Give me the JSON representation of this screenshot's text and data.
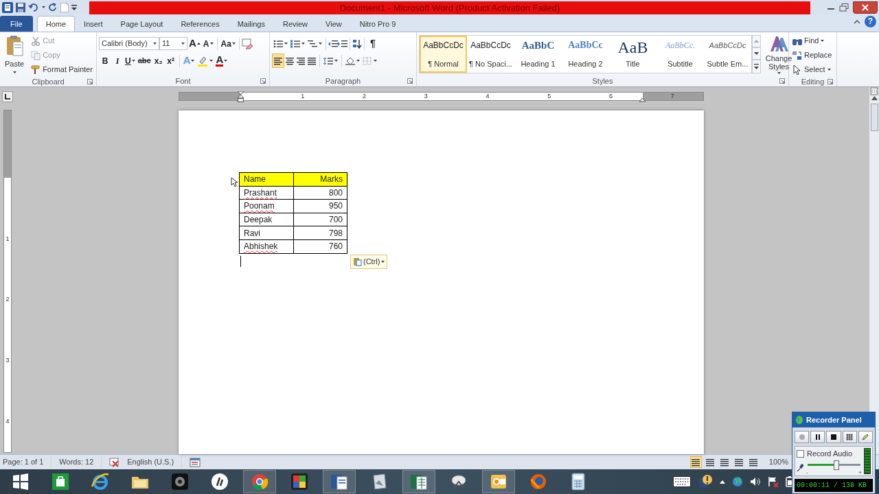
{
  "window": {
    "title": "Document1  -  Microsoft Word (Product Activation Failed)",
    "help_label": "?"
  },
  "tabs": [
    {
      "label": "File",
      "kind": "file",
      "selected": false
    },
    {
      "label": "Home",
      "kind": "tab",
      "selected": true
    },
    {
      "label": "Insert",
      "kind": "tab",
      "selected": false
    },
    {
      "label": "Page Layout",
      "kind": "tab",
      "selected": false
    },
    {
      "label": "References",
      "kind": "tab",
      "selected": false
    },
    {
      "label": "Mailings",
      "kind": "tab",
      "selected": false
    },
    {
      "label": "Review",
      "kind": "tab",
      "selected": false
    },
    {
      "label": "View",
      "kind": "tab",
      "selected": false
    },
    {
      "label": "Nitro Pro 9",
      "kind": "tab",
      "selected": false
    }
  ],
  "clipboard": {
    "label": "Clipboard",
    "paste": "Paste",
    "items": [
      {
        "label": "Cut",
        "kind": "cut",
        "disabled": true
      },
      {
        "label": "Copy",
        "kind": "copy",
        "disabled": true
      },
      {
        "label": "Format Painter",
        "kind": "painter",
        "disabled": false
      }
    ]
  },
  "font": {
    "label": "Font",
    "font_name": "Calibri (Body)",
    "font_size": "11",
    "row1": [
      {
        "label": "A",
        "kind": "grow"
      },
      {
        "label": "A",
        "kind": "shrink"
      },
      {
        "label": "Aa",
        "kind": "case"
      }
    ],
    "row2": [
      {
        "label": "B",
        "kind": "bold"
      },
      {
        "label": "I",
        "kind": "italic"
      },
      {
        "label": "U",
        "kind": "underline"
      },
      {
        "label": "abc",
        "kind": "strike"
      },
      {
        "label": "x₂",
        "kind": "sub"
      },
      {
        "label": "x²",
        "kind": "sup"
      },
      {
        "label": "A",
        "kind": "effects"
      },
      {
        "label": "A",
        "kind": "color"
      }
    ]
  },
  "paragraph": {
    "label": "Paragraph",
    "pilcrow": "¶",
    "alignment": [
      {
        "selected": true
      },
      {
        "selected": false
      },
      {
        "selected": false
      },
      {
        "selected": false
      }
    ]
  },
  "styles": {
    "label": "Styles",
    "change_styles": "Change Styles",
    "items": [
      {
        "preview": "AaBbCcDc",
        "label": "¶ Normal",
        "kind": "body",
        "selected": true
      },
      {
        "preview": "AaBbCcDc",
        "label": "¶ No Spaci...",
        "kind": "body",
        "selected": false
      },
      {
        "preview": "AaBbC",
        "label": "Heading 1",
        "kind": "heading1",
        "selected": false
      },
      {
        "preview": "AaBbCc",
        "label": "Heading 2",
        "kind": "heading2",
        "selected": false
      },
      {
        "preview": "AaB",
        "label": "Title",
        "kind": "title",
        "selected": false
      },
      {
        "preview": "AaBbCc.",
        "label": "Subtitle",
        "kind": "subtitle",
        "selected": false
      },
      {
        "preview": "AaBbCcDc",
        "label": "Subtle Em...",
        "kind": "emphasis",
        "selected": false
      }
    ]
  },
  "editing": {
    "label": "Editing",
    "items": [
      {
        "label": "Find",
        "kind": "find"
      },
      {
        "label": "Replace",
        "kind": "replace"
      },
      {
        "label": "Select",
        "kind": "select"
      }
    ]
  },
  "ruler": {
    "numbers": [
      "1",
      "2",
      "3",
      "4",
      "5",
      "6",
      "7"
    ]
  },
  "vertical_ruler": {
    "numbers": [
      "1",
      "2",
      "3",
      "4"
    ]
  },
  "table": {
    "columns": [
      {
        "label": "Name",
        "numeric": false
      },
      {
        "label": "Marks",
        "numeric": true
      }
    ],
    "rows": [
      {
        "name": "Prashant",
        "marks": "800",
        "misspelled": true
      },
      {
        "name": "Poonam",
        "marks": "950",
        "misspelled": true
      },
      {
        "name": "Deepak",
        "marks": "700",
        "misspelled": false
      },
      {
        "name": "Ravi",
        "marks": "798",
        "misspelled": false
      },
      {
        "name": "Abhishek",
        "marks": "760",
        "misspelled": true
      }
    ]
  },
  "paste_options": {
    "label": "(Ctrl)"
  },
  "status_bar": {
    "page": "Page: 1 of 1",
    "words": "Words: 12",
    "language": "English (U.S.)",
    "zoom": "100%",
    "views": [
      {
        "selected": true
      },
      {
        "selected": false
      },
      {
        "selected": false
      },
      {
        "selected": false
      },
      {
        "selected": false
      }
    ]
  },
  "taskbar": {
    "apps": [
      {
        "kind": "windows",
        "running": false
      },
      {
        "kind": "store",
        "running": false
      },
      {
        "kind": "ie",
        "running": false
      },
      {
        "kind": "folder",
        "running": false
      },
      {
        "kind": "webcam",
        "running": false
      },
      {
        "kind": "hp",
        "running": false
      },
      {
        "kind": "chrome",
        "running": true
      },
      {
        "kind": "puzzle",
        "running": false
      },
      {
        "kind": "word",
        "running": true
      },
      {
        "kind": "paper",
        "running": false
      },
      {
        "kind": "excel",
        "running": true
      },
      {
        "kind": "satellite",
        "running": false
      },
      {
        "kind": "outlook",
        "running": true
      },
      {
        "kind": "firefox",
        "running": false
      },
      {
        "kind": "calculator",
        "running": false
      }
    ]
  },
  "recorder_panel": {
    "title": "Recorder Panel",
    "record_audio": {
      "label": "Record Audio",
      "checked": false
    },
    "mic": {
      "level": 0.55,
      "min_label": "-",
      "max_label": "+"
    },
    "timer": "00:00:11 / 138 KB"
  }
}
